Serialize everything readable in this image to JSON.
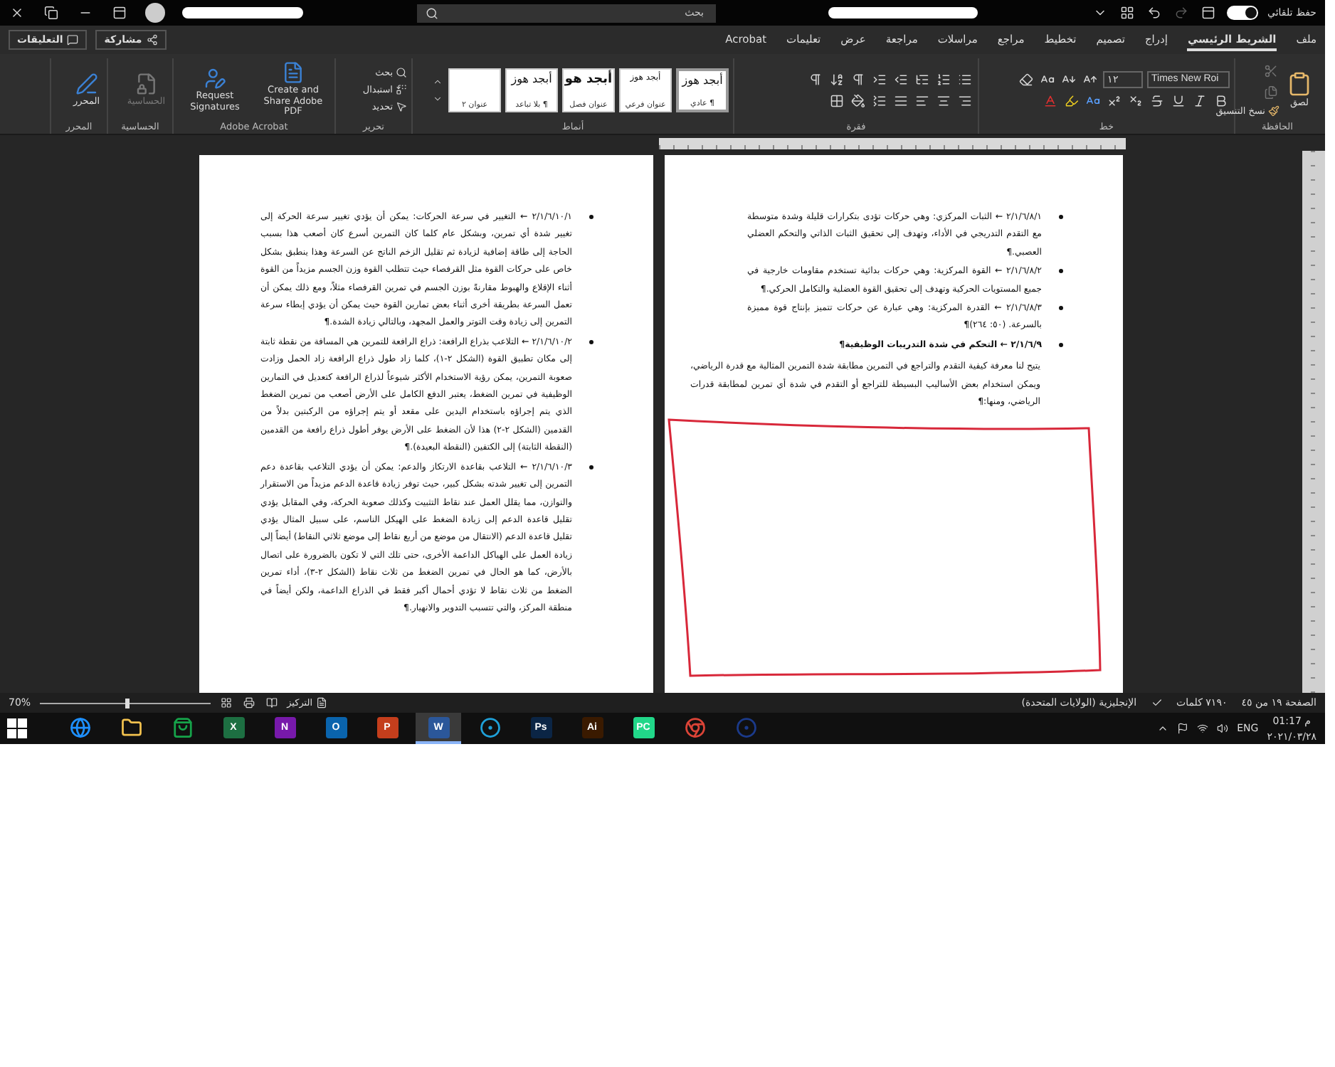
{
  "title_bar": {
    "autosave": {
      "label": "حفظ تلقائي",
      "on": true
    },
    "search": {
      "placeholder": "بحث"
    }
  },
  "tabs": [
    {
      "label": "ملف",
      "selected": false
    },
    {
      "label": "الشريط الرئيسي",
      "selected": true
    },
    {
      "label": "إدراج",
      "selected": false
    },
    {
      "label": "تصميم",
      "selected": false
    },
    {
      "label": "تخطيط",
      "selected": false
    },
    {
      "label": "مراجع",
      "selected": false
    },
    {
      "label": "مراسلات",
      "selected": false
    },
    {
      "label": "مراجعة",
      "selected": false
    },
    {
      "label": "عرض",
      "selected": false
    },
    {
      "label": "تعليمات",
      "selected": false
    },
    {
      "label": "Acrobat",
      "selected": false
    }
  ],
  "share_button": "مشاركة",
  "comments_button": "التعليقات",
  "ribbon": {
    "clipboard": {
      "title": "الحافظة",
      "paste": "لصق",
      "format_painter": "نسخ التنسيق"
    },
    "font": {
      "title": "خط",
      "name": "Times New Roi",
      "size": "١٢"
    },
    "paragraph": {
      "title": "فقرة"
    },
    "styles": {
      "title": "أنماط",
      "items": [
        {
          "sample": "أبجد هوز",
          "label": "¶ عادي",
          "selected": true,
          "kind": "normal"
        },
        {
          "sample": "أبجد هوز",
          "label": "عنوان فرعي",
          "selected": false,
          "kind": "small"
        },
        {
          "sample": "أبجد هو",
          "label": "عنوان فصل",
          "selected": false,
          "kind": "bold"
        },
        {
          "sample": "أبجد هوز",
          "label": "¶ بلا تباعد",
          "selected": false,
          "kind": "normal"
        },
        {
          "label": "عنوان ٢",
          "selected": false,
          "kind": "blank"
        }
      ]
    },
    "editing": {
      "title": "تحرير",
      "items": [
        {
          "label": "بحث",
          "kind": "find"
        },
        {
          "label": "استبدال",
          "kind": "replace"
        },
        {
          "label": "تحديد",
          "kind": "select"
        }
      ]
    },
    "acrobat": {
      "title": "Adobe Acrobat",
      "items": [
        {
          "label": "Create and Share Adobe PDF",
          "kind": "pdf"
        },
        {
          "label": "Request Signatures",
          "kind": "sign"
        }
      ]
    },
    "sensitivity": {
      "title": "الحساسية",
      "label": "الحساسية",
      "disabled": true
    },
    "editor": {
      "title": "المحرر",
      "label": "المحرر"
    }
  },
  "pages": [
    {
      "paragraphs": [
        {
          "kind": "sub_bullet",
          "text": "٢/١/٦/٨/١ ← الثبات المركزي: وهي حركات تؤدى بتكرارات قليلة وشدة متوسطة مع التقدم التدريجي في الأداء، وتهدف إلى تحقيق الثبات الذاتي والتحكم العضلي العصبي.¶"
        },
        {
          "kind": "sub_bullet",
          "text": "٢/١/٦/٨/٢ ← القوة المركزية: وهي حركات بدائية تستخدم مقاومات خارجية في جميع المستويات الحركية وتهدف إلى تحقيق القوة العضلية والتكامل الحركي.¶"
        },
        {
          "kind": "sub_bullet",
          "text": "٢/١/٦/٨/٣ ← القدرة المركزية: وهي عبارة عن حركات تتميز بإنتاج قوة مميزة بالسرعة. (٥٠: ٢٦٤)¶"
        },
        {
          "kind": "heading",
          "text": "٢/١/٦/٩ ← التحكم في شدة التدريبات الوظيفية¶"
        },
        {
          "kind": "body",
          "text": "يتيح لنا معرفة كيفية التقدم والتراجع في التمرين مطابقة شدة التمرين المثالية مع قدرة الرياضي، ويمكن استخدام بعض الأساليب البسيطة للتراجع أو التقدم في شدة أي تمرين لمطابقة قدرات الرياضي، ومنها:¶"
        }
      ]
    },
    {
      "paragraphs": [
        {
          "kind": "bullet",
          "text": "٢/١/٦/١٠/١ ← التغيير في سرعة الحركات: يمكن أن يؤدي تغيير سرعة الحركة إلى تغيير شدة أي تمرين، وبشكل عام كلما كان التمرين أسرع كان أصعب هذا بسبب الحاجة إلى طاقة إضافية لزيادة ثم تقليل الزخم الناتج عن السرعة وهذا ينطبق بشكل خاص على حركات القوة مثل القرفصاء حيث تتطلب القوة وزن الجسم مزيداً من القوة أثناء الإقلاع والهبوط مقارنةً بوزن الجسم في تمرين القرفصاء مثلاً، ومع ذلك يمكن أن تعمل السرعة بطريقة أخرى أثناء بعض تمارين القوة حيث يمكن أن يؤدي إبطاء سرعة التمرين إلى زيادة وقت التوتر والعمل المجهد، وبالتالي زيادة الشدة.¶"
        },
        {
          "kind": "bullet",
          "text": "٢/١/٦/١٠/٢ ← التلاعب بذراع الرافعة: ذراع الرافعة للتمرين هي المسافة من نقطة ثابتة إلى مكان تطبيق القوة (الشكل ٢-١)، كلما زاد طول ذراع الرافعة زاد الحمل وزادت صعوبة التمرين، يمكن رؤية الاستخدام الأكثر شيوعاً لذراع الرافعة كتعديل في التمارين الوظيفية في تمرين الضغط، يعتبر الدفع الكامل على الأرض أصعب من تمرين الضغط الذي يتم إجراؤه باستخدام اليدين على مقعد أو يتم إجراؤه من الركبتين بدلاً من القدمين (الشكل ٢-٢) هذا لأن الضغط على الأرض يوفر أطول ذراع رافعة من القدمين (النقطة الثابتة) إلى الكتفين (النقطة البعيدة).¶"
        },
        {
          "kind": "bullet",
          "text": "٢/١/٦/١٠/٣ ← التلاعب بقاعدة الارتكاز والدعم: يمكن أن يؤدي التلاعب بقاعدة دعم التمرين إلى تغيير شدته بشكل كبير، حيث توفر زيادة قاعدة الدعم مزيداً من الاستقرار والتوازن، مما يقلل العمل عند نقاط التثبيت وكذلك صعوبة الحركة، وفي المقابل يؤدي تقليل قاعدة الدعم إلى زيادة الضغط على الهيكل الناسم، على سبيل المثال يؤدي تقليل قاعدة الدعم (الانتقال من موضع من أربع نقاط إلى موضع ثلاثي النقاط) أيضاً إلى زيادة العمل على الهياكل الداعمة الأخرى، حتى تلك التي لا تكون بالضرورة على اتصال بالأرض، كما هو الحال في تمرين الضغط من ثلاث نقاط (الشكل ٢-٣)، أداء تمرين الضغط من ثلاث نقاط لا تؤدي أحمال أكبر فقط في الذراع الداعمة، ولكن أيضاً في منطقة المركز، والتي تتسبب التدوير والانهيار.¶"
        }
      ]
    }
  ],
  "status_bar": {
    "page": "الصفحة ١٩ من ٤٥",
    "words": "٧١٩٠ كلمات",
    "language": "الإنجليزية (الولايات المتحدة)",
    "focus": "التركيز",
    "zoom": "70%",
    "zoom_slider": {
      "level": 0.5
    }
  },
  "taskbar": {
    "apps": [
      {
        "kind": "cinema",
        "color": "#1b3a8a",
        "selected": false
      },
      {
        "kind": "chrome",
        "color": "#db4437",
        "selected": false
      },
      {
        "kind": "letter",
        "label": "PC",
        "color": "#21d789",
        "selected": false
      },
      {
        "kind": "letter",
        "label": "Ai",
        "color": "#3a1a00",
        "selected": false
      },
      {
        "kind": "letter",
        "label": "Ps",
        "color": "#0b2545",
        "selected": false
      },
      {
        "kind": "edge",
        "color": "#1fa0d8",
        "selected": false
      },
      {
        "kind": "letter",
        "label": "W",
        "color": "#2b579a",
        "selected": true
      },
      {
        "kind": "letter",
        "label": "P",
        "color": "#c43e1c",
        "selected": false
      },
      {
        "kind": "letter",
        "label": "O",
        "color": "#0a64ad",
        "selected": false
      },
      {
        "kind": "letter",
        "label": "N",
        "color": "#7719aa",
        "selected": false
      },
      {
        "kind": "letter",
        "label": "X",
        "color": "#1d6f42",
        "selected": false
      },
      {
        "kind": "store",
        "color": "#16a34a",
        "selected": false
      },
      {
        "kind": "folder",
        "color": "#f2c14e",
        "selected": false
      },
      {
        "kind": "ie",
        "color": "#1e90ff",
        "selected": false
      }
    ],
    "tray": {
      "language": "ENG",
      "time": "م 01:17",
      "date": "٢٠٢١/٠٣/٢٨"
    }
  }
}
